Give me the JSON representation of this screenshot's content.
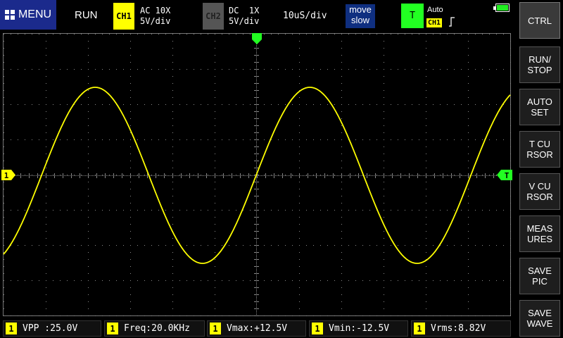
{
  "topbar": {
    "menu_label": "MENU",
    "run_state": "RUN",
    "ch1": {
      "tag": "CH1",
      "coupling": "AC 10X",
      "scale": "5V/div",
      "color": "#ffff00"
    },
    "ch2": {
      "tag": "CH2",
      "coupling": "DC  1X",
      "scale": "5V/div",
      "color": "#555555"
    },
    "timebase": "10uS/div",
    "move_speed": {
      "line1": "move",
      "line2": "slow"
    },
    "trigger": {
      "tag": "T",
      "mode": "Auto",
      "source": "CH1",
      "edge": "rising-edge-icon"
    },
    "battery_icon": "battery-icon"
  },
  "sidebar": {
    "buttons": [
      {
        "label": "CTRL"
      },
      {
        "label": "RUN/\nSTOP"
      },
      {
        "label": "AUTO\nSET"
      },
      {
        "label": "T CU\nRSOR"
      },
      {
        "label": "V CU\nRSOR"
      },
      {
        "label": "MEAS\nURES"
      },
      {
        "label": "SAVE\nPIC"
      },
      {
        "label": "SAVE\nWAVE"
      }
    ]
  },
  "markers": {
    "ch1": "1",
    "trigger": "T"
  },
  "measurements": [
    {
      "ch": "1",
      "label": "VPP :25.0V"
    },
    {
      "ch": "1",
      "label": "Freq:20.0KHz"
    },
    {
      "ch": "1",
      "label": "Vmax:+12.5V"
    },
    {
      "ch": "1",
      "label": "Vmin:-12.5V"
    },
    {
      "ch": "1",
      "label": "Vrms:8.82V"
    }
  ],
  "waveform": {
    "channel": "CH1",
    "amplitude_v": 12.5,
    "frequency_khz": 20.0,
    "color": "#ffff00"
  }
}
